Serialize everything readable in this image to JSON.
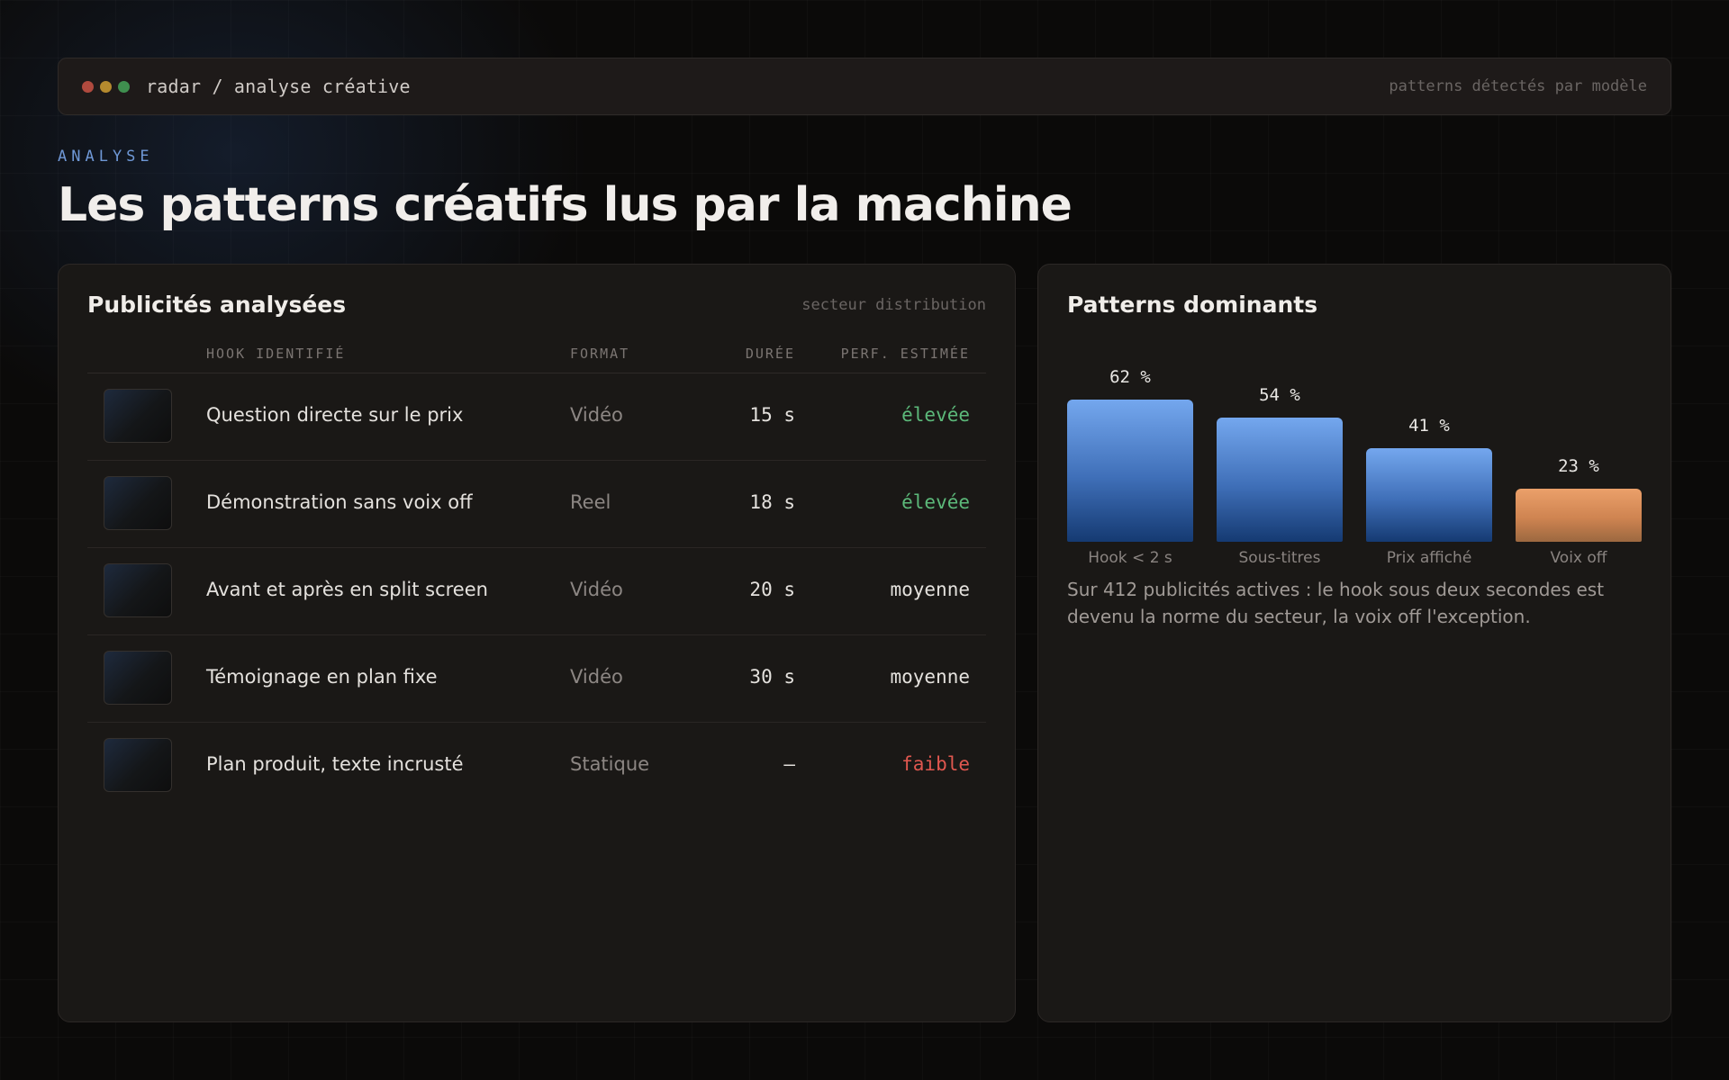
{
  "window": {
    "breadcrumb": "radar / analyse créative",
    "tagline": "patterns détectés par modèle",
    "dot_colors": [
      "#b04a3e",
      "#b58a2e",
      "#3f8f4f"
    ]
  },
  "header": {
    "eyebrow": "ANALYSE",
    "title": "Les patterns créatifs lus par la machine"
  },
  "ads_panel": {
    "title": "Publicités analysées",
    "subtitle": "secteur distribution",
    "columns": [
      "HOOK IDENTIFIÉ",
      "FORMAT",
      "DURÉE",
      "PERF. ESTIMÉE"
    ],
    "rows": [
      {
        "hook": "Question directe sur le prix",
        "format": "Vidéo",
        "duree": "15 s",
        "perf": "élevée",
        "level": "high"
      },
      {
        "hook": "Démonstration sans voix off",
        "format": "Reel",
        "duree": "18 s",
        "perf": "élevée",
        "level": "high"
      },
      {
        "hook": "Avant et après en split screen",
        "format": "Vidéo",
        "duree": "20 s",
        "perf": "moyenne",
        "level": "mid"
      },
      {
        "hook": "Témoignage en plan fixe",
        "format": "Vidéo",
        "duree": "30 s",
        "perf": "moyenne",
        "level": "mid"
      },
      {
        "hook": "Plan produit, texte incrusté",
        "format": "Statique",
        "duree": "—",
        "perf": "faible",
        "level": "low"
      }
    ]
  },
  "patterns_panel": {
    "title": "Patterns dominants",
    "note": "Sur 412 publicités actives : le hook sous deux secondes est devenu la norme du secteur, la voix off l'exception."
  },
  "chart_data": {
    "type": "bar",
    "categories": [
      "Hook < 2 s",
      "Sous-titres",
      "Prix affiché",
      "Voix off"
    ],
    "values": [
      62,
      54,
      41,
      23
    ],
    "value_labels": [
      "62 %",
      "54 %",
      "41 %",
      "23 %"
    ],
    "highlight": [
      false,
      false,
      false,
      true
    ],
    "colors": {
      "primary": "#5b8fdc",
      "highlight": "#e19662"
    },
    "ylim": [
      0,
      100
    ],
    "grid": false
  }
}
